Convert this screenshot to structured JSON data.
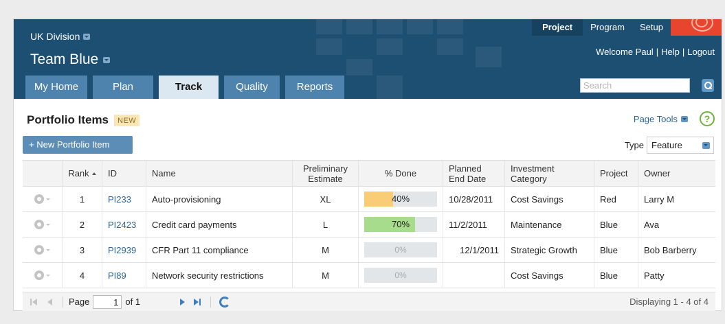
{
  "header": {
    "division": "UK Division",
    "team": "Team Blue",
    "topnav": [
      {
        "label": "Project",
        "active": true
      },
      {
        "label": "Program",
        "active": false
      },
      {
        "label": "Setup",
        "active": false
      }
    ],
    "welcome": "Welcome Paul",
    "help_link": "Help",
    "logout_link": "Logout",
    "separator": "|",
    "tabs": [
      {
        "label": "My Home",
        "active": false
      },
      {
        "label": "Plan",
        "active": false
      },
      {
        "label": "Track",
        "active": true
      },
      {
        "label": "Quality",
        "active": false
      },
      {
        "label": "Reports",
        "active": false
      }
    ],
    "search_placeholder": "Search"
  },
  "page": {
    "title": "Portfolio Items",
    "badge": "NEW",
    "page_tools": "Page Tools",
    "help": "?",
    "new_button": "+ New Portfolio Item",
    "type_label": "Type",
    "type_value": "Feature"
  },
  "grid": {
    "columns": {
      "rank": "Rank",
      "id": "ID",
      "name": "Name",
      "estimate": "Preliminary Estimate",
      "done": "% Done",
      "end": "Planned End Date",
      "category": "Investment Category",
      "project": "Project",
      "owner": "Owner"
    },
    "rows": [
      {
        "rank": "1",
        "id": "PI233",
        "name": "Auto-provisioning",
        "estimate": "XL",
        "done_label": "40%",
        "done_fraction": 0.4,
        "done_color": "#f8cd76",
        "end": "10/28/2011",
        "category": "Cost Savings",
        "project": "Red",
        "owner": "Larry M"
      },
      {
        "rank": "2",
        "id": "PI2423",
        "name": "Credit card payments",
        "estimate": "L",
        "done_label": "70%",
        "done_fraction": 0.7,
        "done_color": "#a7dc8c",
        "end": "11/2/2011",
        "category": "Maintenance",
        "project": "Blue",
        "owner": "Ava"
      },
      {
        "rank": "3",
        "id": "PI2939",
        "name": "CFR Part 11 compliance",
        "estimate": "M",
        "done_label": "0%",
        "done_fraction": 0,
        "done_color": "#e3e6e9",
        "end": "12/1/2011",
        "category": "Strategic Growth",
        "project": "Blue",
        "owner": "Bob Barberry"
      },
      {
        "rank": "4",
        "id": "PI89",
        "name": "Network security restrictions",
        "estimate": "M",
        "done_label": "0%",
        "done_fraction": 0,
        "done_color": "#e3e6e9",
        "end": "",
        "category": "Cost Savings",
        "project": "Blue",
        "owner": "Patty"
      }
    ]
  },
  "pager": {
    "page_label": "Page",
    "page_value": "1",
    "of_label": "of 1",
    "display": "Displaying 1 - 4 of 4"
  }
}
